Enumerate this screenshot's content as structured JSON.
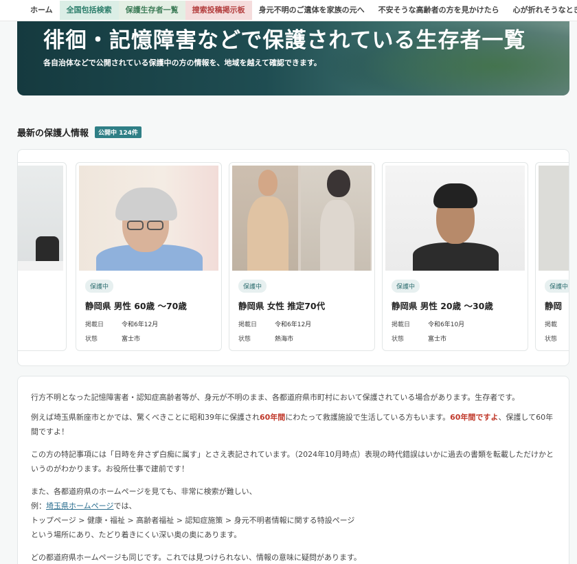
{
  "nav": {
    "items": [
      {
        "label": "ホーム"
      },
      {
        "label": "全国包括検索"
      },
      {
        "label": "保護生存者一覧"
      },
      {
        "label": "捜索投稿掲示板"
      },
      {
        "label": "身元不明のご遺体を家族の元へ"
      },
      {
        "label": "不安そうな高齢者の方を見かけたら"
      },
      {
        "label": "心が折れそうなときの杖"
      }
    ]
  },
  "hero": {
    "title": "徘徊・記憶障害などで保護されている生存者一覧",
    "subtitle": "各自治体などで公開されている保護中の方の情報を、地域を越えて確認できます。"
  },
  "section": {
    "title": "最新の保護人情報",
    "badge": "公開中 124件"
  },
  "cards": [
    {
      "status": "保護中",
      "title": "静岡県 男性 60歳 〜70歳",
      "k1": "掲載日",
      "v1": "令和6年12月",
      "k2": "状態",
      "v2": "富士市"
    },
    {
      "status": "保護中",
      "title": "静岡県 女性 推定70代",
      "k1": "掲載日",
      "v1": "令和6年12月",
      "k2": "状態",
      "v2": "熱海市"
    },
    {
      "status": "保護中",
      "title": "静岡県 男性 20歳 〜30歳",
      "k1": "掲載日",
      "v1": "令和6年10月",
      "k2": "状態",
      "v2": "富士市"
    },
    {
      "status": "保護中",
      "title": "静岡",
      "k1": "掲載",
      "k2": "状態"
    }
  ],
  "article": {
    "p1": "行方不明となった記憶障害者・認知症高齢者等が、身元が不明のまま、各都道府県市町村において保護されている場合があります。生存者です。",
    "p2a": "例えば埼玉県新座市とかでは、驚くべきことに昭和39年に保護され",
    "p2b": "60年間",
    "p2c": "にわたって救護施設で生活している方もいます。",
    "p2d": "60年間ですよ",
    "p2e": "、保護して60年間ですよ！",
    "p3": "この方の特記事項には「日時を弁さず白痴に属す」とさえ表記されています。（2024年10月時点）表現の時代錯誤はいかに過去の書類を転載しただけかというのがわかります。お役所仕事で建前です！",
    "p4a": "また、各都道府県のホームページを見ても、非常に検索が難しい、",
    "p4b": "例：",
    "p4link": "埼玉県ホームページ",
    "p4c": "では、",
    "p4d": "トップページ > 健康・福祉 > 高齢者福祉 > 認知症施策 > 身元不明者情報に関する特設ページ",
    "p4e": "という場所にあり、たどり着きにくい深い奥の奥にあります。",
    "p5": "どの都道府県ホームページも同じです。これでは見つけられない、情報の意味に疑問があります。"
  }
}
